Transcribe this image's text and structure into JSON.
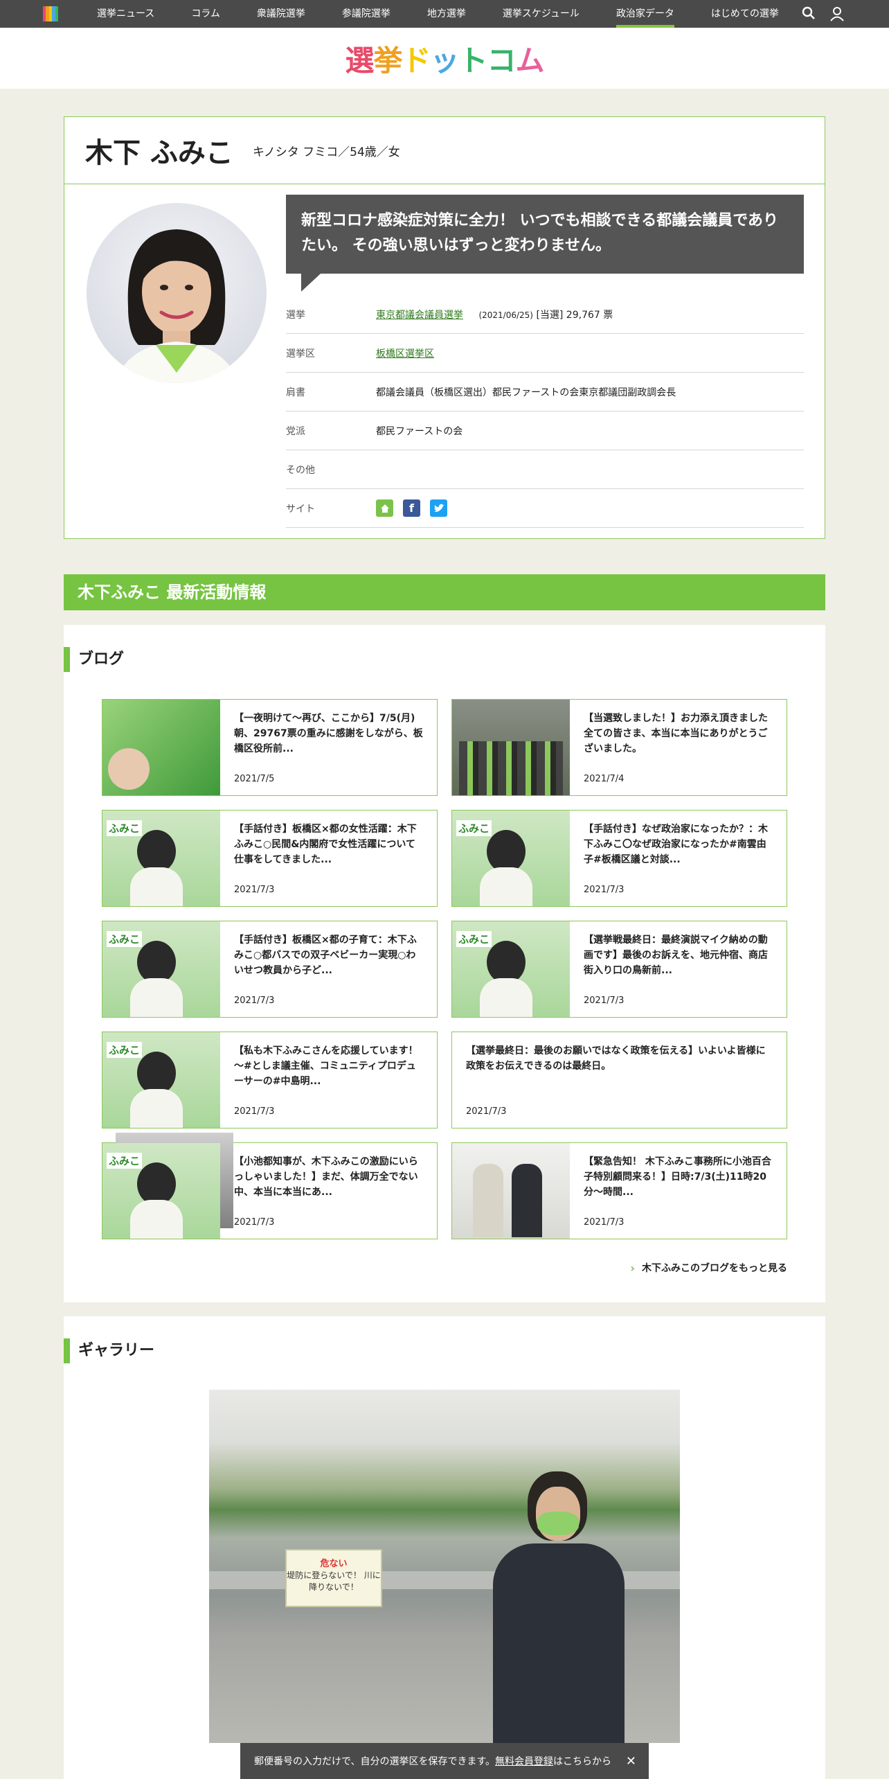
{
  "nav": {
    "items": [
      "選挙ニュース",
      "コラム",
      "衆議院選挙",
      "参議院選挙",
      "地方選挙",
      "選挙スケジュール",
      "政治家データ",
      "はじめての選挙"
    ],
    "active_index": 6,
    "icons": [
      "search-icon",
      "user-icon"
    ]
  },
  "brand": {
    "logo_text": "選挙ドットコム"
  },
  "profile": {
    "name": "木下 ふみこ",
    "kana_age_gender": "キノシタ フミコ／54歳／女",
    "quote": "新型コロナ感染症対策に全力！ いつでも相談できる都議会議員でありたい。 その強い思いはずっと変わりません。",
    "rows": {
      "election": {
        "label": "選挙",
        "link": "東京都議会議員選挙",
        "detail": "(2021/06/25)",
        "result": "[当選] 29,767 票"
      },
      "district": {
        "label": "選挙区",
        "link": "板橋区選挙区"
      },
      "title": {
        "label": "肩書",
        "value": "都議会議員（板橋区選出）都民ファーストの会東京都議団副政調会長"
      },
      "party": {
        "label": "党派",
        "value": "都民ファーストの会"
      },
      "other": {
        "label": "その他",
        "value": ""
      },
      "site": {
        "label": "サイト"
      }
    },
    "site_icons": [
      "home-icon",
      "facebook-icon",
      "twitter-icon"
    ]
  },
  "activity": {
    "heading": "木下ふみこ 最新活動情報"
  },
  "blog": {
    "heading": "ブログ",
    "posts": [
      {
        "title": "【一夜明けて〜再び、ここから】7/5(月)朝、29767票の重みに感謝をしながら、板橋区役所前...",
        "date": "2021/7/5"
      },
      {
        "title": "【当選致しました！】お力添え頂きました全ての皆さま、本当に本当にありがとうございました。",
        "date": "2021/7/4"
      },
      {
        "title": "【手話付き】板橋区×都の女性活躍：木下ふみこ○民間&内閣府で女性活躍について仕事をしてきました...",
        "date": "2021/7/3"
      },
      {
        "title": "【手話付き】なぜ政治家になったか？：木下ふみこ〇なぜ政治家になったか#南雲由子#板橋区議と対談...",
        "date": "2021/7/3"
      },
      {
        "title": "【手話付き】板橋区×都の子育て：木下ふみこ○都バスでの双子ベビーカー実現○わいせつ教員から子ど...",
        "date": "2021/7/3"
      },
      {
        "title": "【選挙戦最終日：最終演説マイク納めの動画です】最後のお訴えを、地元仲宿、商店街入り口の鳥新前...",
        "date": "2021/7/3"
      },
      {
        "title": "【私も木下ふみこさんを応援しています！ 〜#としま議主催、コミュニティプロデューサーの#中島明...",
        "date": "2021/7/3"
      },
      {
        "title": "【選挙最終日：最後のお願いではなく政策を伝える】いよいよ皆様に政策をお伝えできるのは最終日。",
        "date": "2021/7/3"
      },
      {
        "title": "【小池都知事が、木下ふみこの激励にいらっしゃいました！】まだ、体調万全でない中、本当に本当にあ...",
        "date": "2021/7/3"
      },
      {
        "title": "【緊急告知！ 木下ふみこ事務所に小池百合子特別顧問来る！】日時:7/3(土)11時20分〜時間...",
        "date": "2021/7/3"
      }
    ],
    "thumb_tag": "ふみこ",
    "more_label": "木下ふみこのブログをもっと見る"
  },
  "gallery": {
    "heading": "ギャラリー",
    "sign_title": "危ない",
    "sign_text": "堤防に登らないで！ 川に降りないで！"
  },
  "banner": {
    "text_before": "郵便番号の入力だけで、自分の選挙区を保存できます。",
    "link": "無料会員登録",
    "text_after": "はこちらから",
    "close": "✕"
  },
  "colors": {
    "accent": "#76c442",
    "border": "#8cc85a",
    "nav_bg": "#4a4a4a",
    "link": "#2f7a1c"
  }
}
